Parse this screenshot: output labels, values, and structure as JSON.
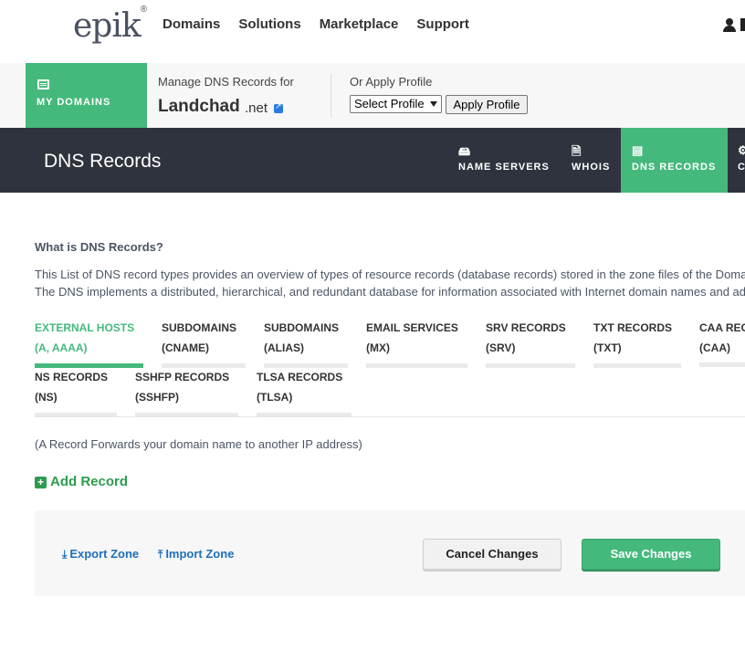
{
  "header": {
    "logo": "epik",
    "logo_mark": "®",
    "nav": [
      "Domains",
      "Solutions",
      "Marketplace",
      "Support"
    ],
    "user_icon": "user-icon"
  },
  "manage": {
    "my_domains_label": "MY DOMAINS",
    "manage_label": "Manage DNS Records for",
    "domain_name": "Landchad",
    "domain_tld": ".net",
    "apply_profile_label": "Or Apply Profile",
    "profile_select_value": "Select Profile",
    "apply_button": "Apply Profile"
  },
  "section": {
    "title": "DNS Records",
    "tabs": [
      {
        "label": "NAME SERVERS",
        "icon": "server-icon"
      },
      {
        "label": "WHOIS",
        "icon": "document-icon"
      },
      {
        "label": "DNS RECORDS",
        "icon": "list-icon",
        "active": true
      },
      {
        "label": "C",
        "icon": "gear-icon"
      }
    ]
  },
  "info": {
    "title": "What is DNS Records?",
    "line1": "This List of DNS record types provides an overview of types of resource records (database records) stored in the zone files of the Doma",
    "line2": "The DNS implements a distributed, hierarchical, and redundant database for information associated with Internet domain names and ad"
  },
  "record_tabs": [
    {
      "name": "EXTERNAL HOSTS",
      "sub": "(A, AAAA)",
      "active": true
    },
    {
      "name": "SUBDOMAINS",
      "sub": "(CNAME)"
    },
    {
      "name": "SUBDOMAINS",
      "sub": "(ALIAS)"
    },
    {
      "name": "EMAIL SERVICES",
      "sub": "(MX)"
    },
    {
      "name": "SRV RECORDS",
      "sub": "(SRV)"
    },
    {
      "name": "TXT RECORDS",
      "sub": "(TXT)"
    },
    {
      "name": "CAA REC",
      "sub": "(CAA)"
    },
    {
      "name": "NS RECORDS",
      "sub": "(NS)"
    },
    {
      "name": "SSHFP RECORDS",
      "sub": "(SSHFP)"
    },
    {
      "name": "TLSA RECORDS",
      "sub": "(TLSA)"
    }
  ],
  "record_note": "(A Record Forwards your domain name to another IP address)",
  "add_record": "Add Record",
  "footer": {
    "export": "Export Zone",
    "import": "Import Zone",
    "cancel": "Cancel Changes",
    "save": "Save Changes"
  },
  "colors": {
    "accent": "#45b97c",
    "dark_bar": "#2f333d",
    "link": "#1f6fba"
  }
}
